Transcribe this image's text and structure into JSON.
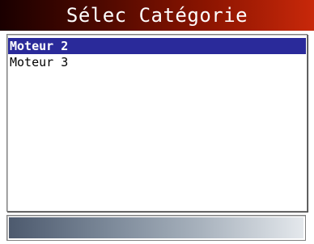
{
  "header": {
    "title": "Sélec Catégorie"
  },
  "list": {
    "items": [
      {
        "label": "Moteur 2",
        "selected": true
      },
      {
        "label": "Moteur 3",
        "selected": false
      }
    ]
  },
  "colors": {
    "title_bar_start": "#1a0000",
    "title_bar_end": "#c8280a",
    "selection": "#2a2a9a",
    "status_bar_start": "#4d5a6e",
    "status_bar_end": "#e4e8ec"
  }
}
